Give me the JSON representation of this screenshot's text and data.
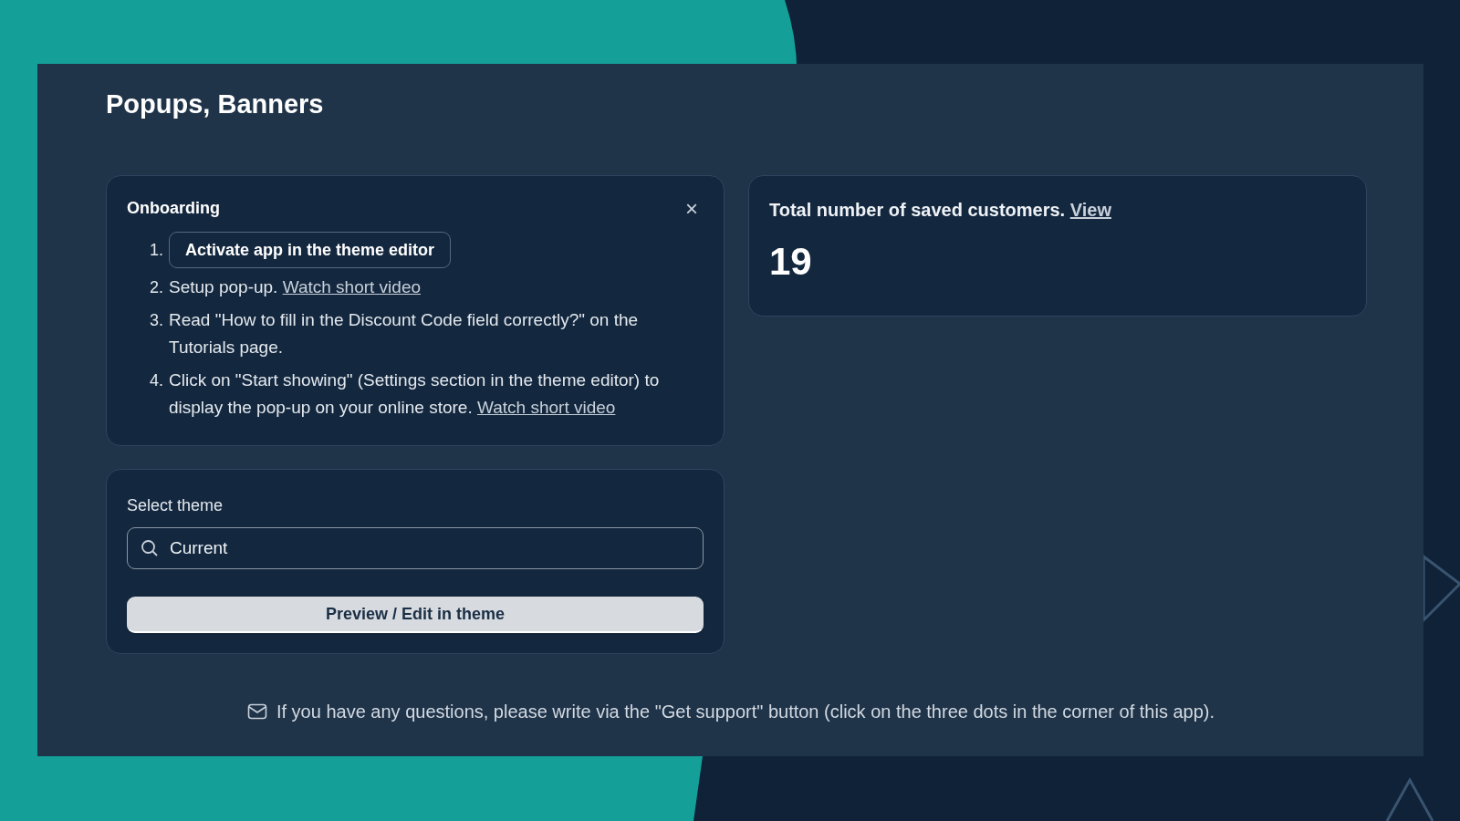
{
  "page": {
    "title": "Popups, Banners"
  },
  "onboarding": {
    "title": "Onboarding",
    "close": "×",
    "steps": [
      {
        "kind": "button",
        "number": "1.",
        "label": "Activate app in the theme editor"
      },
      {
        "kind": "text",
        "number": "2.",
        "text": "Setup pop-up.",
        "link": "Watch short video"
      },
      {
        "kind": "text",
        "number": "3.",
        "text": "Read \"How to fill in the Discount Code field correctly?\" on the Tutorials page."
      },
      {
        "kind": "text",
        "number": "4.",
        "text": "Click on \"Start showing\" (Settings section in the theme editor) to display the pop-up on your online store.",
        "link": "Watch short video"
      }
    ]
  },
  "theme": {
    "label": "Select theme",
    "value": "Current",
    "button": "Preview / Edit in theme"
  },
  "customers": {
    "text": "Total number of saved customers.",
    "link": "View",
    "count": "19"
  },
  "footer": {
    "text": "If you have any questions, please write via the \"Get support\" button (click on the three dots in the corner of this app)."
  }
}
